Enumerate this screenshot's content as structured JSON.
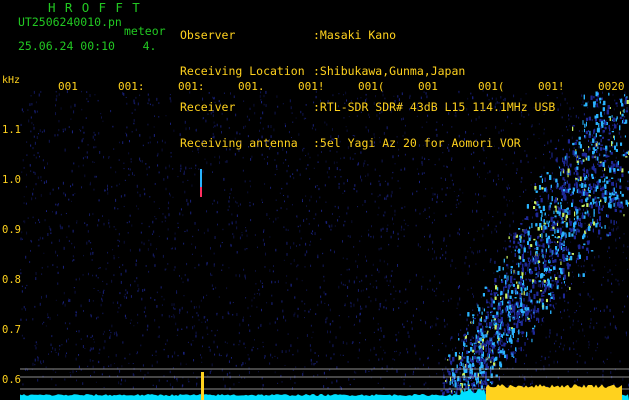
{
  "header": {
    "brand": "H R O F F T",
    "filename": "UT2506240010.pn",
    "kind": "meteor",
    "timestamp": "25.06.24 00:10    4.",
    "meta": [
      {
        "label": "Observer",
        "value": ":Masaki Kano"
      },
      {
        "label": "Receiving Location",
        "value": ":Shibukawa,Gunma,Japan"
      },
      {
        "label": "Receiver",
        "value": ":RTL-SDR SDR# 43dB L15 114.1MHz USB"
      },
      {
        "label": "Receiving antenna",
        "value": ":5el Yagi Az 20 for Aomori VOR"
      }
    ]
  },
  "chart_data": {
    "type": "heatmap",
    "ylabel": "kHz",
    "x_tick_labels": [
      "001",
      "001:",
      "001:",
      "001.",
      "001!",
      "001(",
      "001",
      "001(",
      "001!",
      "0020"
    ],
    "y_ticks": [
      0.6,
      0.7,
      0.8,
      0.9,
      1.0,
      1.1
    ],
    "ylim": [
      0.58,
      1.18
    ],
    "colors": {
      "background": "#000000",
      "noise": "#1e2896",
      "signal": "#2ab4ff",
      "peak": "#c8f064",
      "meteor": "#ff3060",
      "level": "#ffd21e",
      "level_low": "#00e0ff",
      "reference_line": "#b0b0b0"
    }
  }
}
